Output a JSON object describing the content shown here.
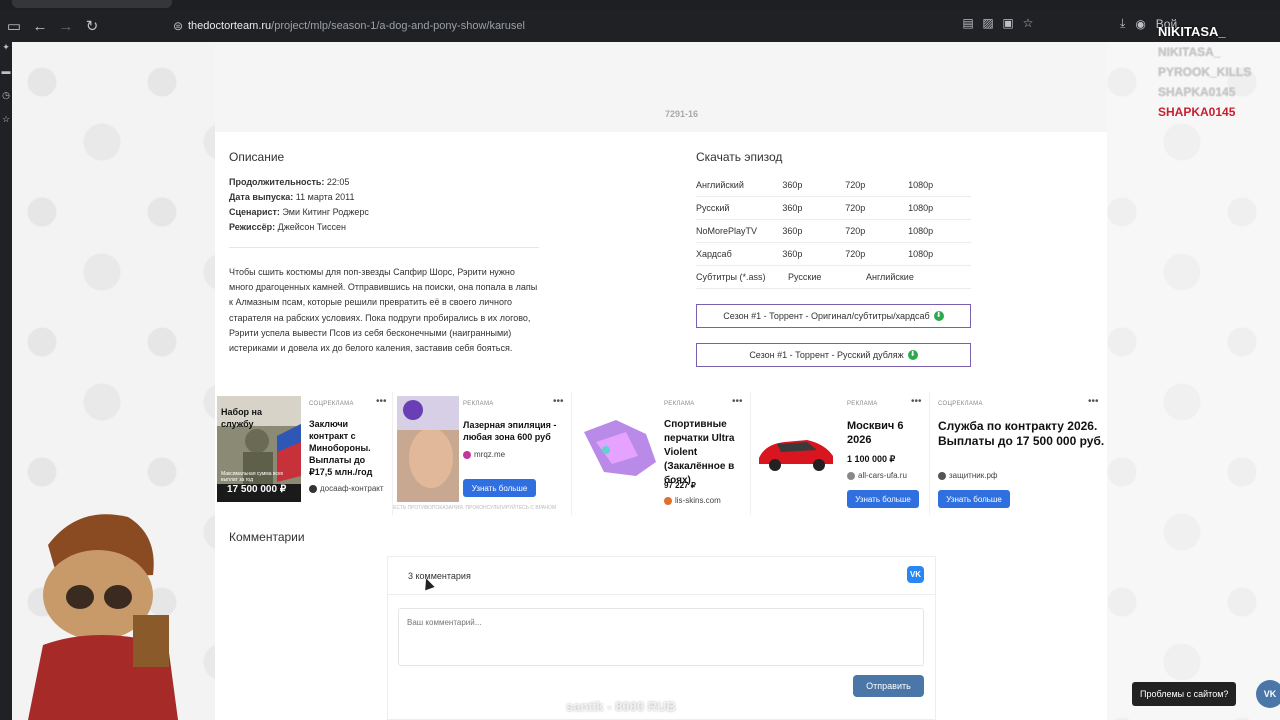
{
  "browser": {
    "url_host": "thedoctorteam.ru",
    "url_path": "/project/mlp/season-1/a-dog-and-pony-show/karusel",
    "profile_label": "Вой"
  },
  "page": {
    "episode_code": "7291-16",
    "description": {
      "title": "Описание",
      "meta": [
        {
          "label": "Продолжительность:",
          "value": " 22:05"
        },
        {
          "label": "Дата выпуска:",
          "value": " 11 марта 2011"
        },
        {
          "label": "Сценарист:",
          "value": " Эми Китинг Роджерс"
        },
        {
          "label": "Режиссёр:",
          "value": " Джейсон Тиссен"
        }
      ],
      "synopsis": "Чтобы сшить костюмы для поп-звезды Сапфир Шорс, Рэрити нужно много драгоценных камней. Отправившись на поиски, она попала в лапы к Алмазным псам, которые решили превратить её в своего личного старателя на рабских условиях. Пока подруги пробирались в их логово, Рэрити успела вывести Псов из себя бесконечными (наигранными) истериками и довела их до белого каления, заставив себя бояться."
    },
    "download": {
      "title": "Скачать эпизод",
      "rows": [
        {
          "lang": "Английский",
          "q1": "360p",
          "q2": "720p",
          "q3": "1080p"
        },
        {
          "lang": "Русский",
          "q1": "360p",
          "q2": "720p",
          "q3": "1080p"
        },
        {
          "lang": "NoMorePlayTV",
          "q1": "360p",
          "q2": "720p",
          "q3": "1080p"
        },
        {
          "lang": "Хардсаб",
          "q1": "360p",
          "q2": "720p",
          "q3": "1080p"
        }
      ],
      "subs": {
        "label": "Субтитры (*.ass)",
        "ru": "Русские",
        "en": "Английские"
      },
      "torrent1": "Сезон #1 - Торрент - Оригинал/субтитры/хардсаб",
      "torrent2": "Сезон #1 - Торрент - Русский дубляж"
    },
    "ads": [
      {
        "label": "СОЦРЕКЛАМА",
        "title": "Заключи контракт с Минобороны. Выплаты до ₽17,5 млн./год",
        "domain": "досааф-контракт",
        "img_top": "Набор на службу",
        "img_badge": "17 500 000 ₽",
        "img_small": "Максимальная сумма всех выплат за год"
      },
      {
        "label": "РЕКЛАМА",
        "title": "Лазерная эпиляция - любая зона 600 руб",
        "domain": "mrqz.me",
        "button": "Узнать больше",
        "disclaimer": "ЕСТЬ ПРОТИВОПОКАЗАНИЯ. ПРОКОНСУЛЬТИРУЙТЕСЬ С ВРАЧОМ"
      },
      {
        "label": "РЕКЛАМА",
        "title": "Спортивные перчатки Ultra Violent (Закалённое в боях)",
        "price": "97 227 ₽",
        "domain": "lis-skins.com"
      },
      {
        "label": "РЕКЛАМА",
        "title": "Москвич 6 2026",
        "price": "1 100 000 ₽",
        "domain": "all-cars-ufa.ru",
        "button": "Узнать больше"
      },
      {
        "label": "СОЦРЕКЛАМА",
        "title": "Служба по контракту 2026. Выплаты до 17 500 000 руб.",
        "domain": "защитник.рф",
        "button": "Узнать больше"
      }
    ],
    "comments": {
      "title": "Комментарии",
      "count": "3 комментария",
      "placeholder": "Ваш комментарий...",
      "submit": "Отправить",
      "vk": "VK"
    }
  },
  "overlay": {
    "names": [
      "NIKITASA_",
      "NIKITASA_",
      "PYROOK_KILLS",
      "SHAPKA0145",
      "SHAPKA0145"
    ],
    "donation": "santik - 8000 RUB",
    "problems": "Проблемы с сайтом?"
  }
}
